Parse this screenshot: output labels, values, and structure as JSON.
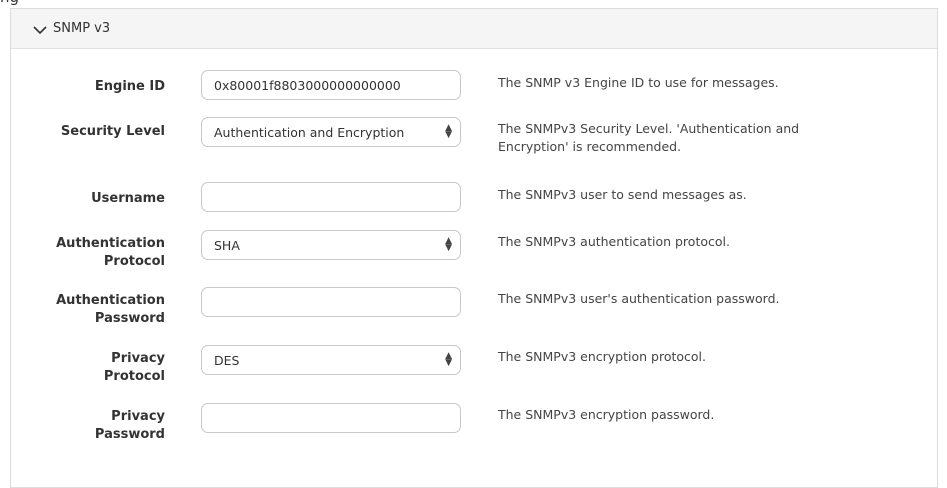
{
  "page_fragment": "ng",
  "section": {
    "title": "SNMP v3",
    "expanded": true,
    "chevron_icon": "chevron-down-icon"
  },
  "fields": {
    "engine_id": {
      "label": "Engine ID",
      "value": "0x80001f8803000000000000",
      "help": "The SNMP v3 Engine ID to use for messages."
    },
    "security_level": {
      "label": "Security Level",
      "value": "Authentication and Encryption",
      "help_line1": "The SNMPv3 Security Level. 'Authentication and",
      "help_line2": "Encryption' is recommended."
    },
    "username": {
      "label": "Username",
      "value": "",
      "help": "The SNMPv3 user to send messages as."
    },
    "auth_protocol": {
      "label_line1": "Authentication",
      "label_line2": "Protocol",
      "value": "SHA",
      "help": "The SNMPv3 authentication protocol."
    },
    "auth_password": {
      "label_line1": "Authentication",
      "label_line2": "Password",
      "value": "",
      "help": "The SNMPv3 user's authentication password."
    },
    "privacy_protocol": {
      "label_line1": "Privacy",
      "label_line2": "Protocol",
      "value": "DES",
      "help": "The SNMPv3 encryption protocol."
    },
    "privacy_password": {
      "label_line1": "Privacy",
      "label_line2": "Password",
      "value": "",
      "help": "The SNMPv3 encryption password."
    }
  },
  "icons": {
    "select_arrows": "updown-arrows-icon"
  }
}
